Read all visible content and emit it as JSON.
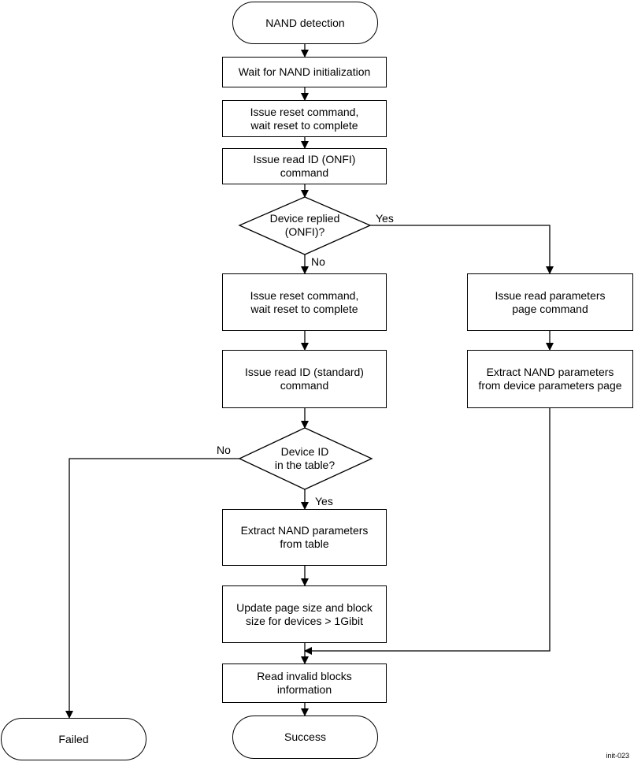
{
  "diagram": {
    "nodes": {
      "start": "NAND detection",
      "wait_init": "Wait for NAND initialization",
      "reset1": "Issue reset command,\nwait reset to complete",
      "read_id_onfi": "Issue read ID (ONFI)\ncommand",
      "decision_onfi": "Device replied\n(ONFI)?",
      "reset2": "Issue reset command,\nwait reset to complete",
      "read_id_std": "Issue read ID (standard)\ncommand",
      "decision_table": "Device ID\nin the table?",
      "extract_table": "Extract NAND parameters\nfrom table",
      "update_size": "Update page size and block\nsize for devices > 1Gibit",
      "read_invalid": "Read invalid blocks\ninformation",
      "success": "Success",
      "read_params_page": "Issue read parameters\npage command",
      "extract_device": "Extract NAND parameters\nfrom device parameters page",
      "failed": "Failed"
    },
    "edge_labels": {
      "onfi_yes": "Yes",
      "onfi_no": "No",
      "table_no": "No",
      "table_yes": "Yes"
    },
    "figure_id": "init-023"
  }
}
